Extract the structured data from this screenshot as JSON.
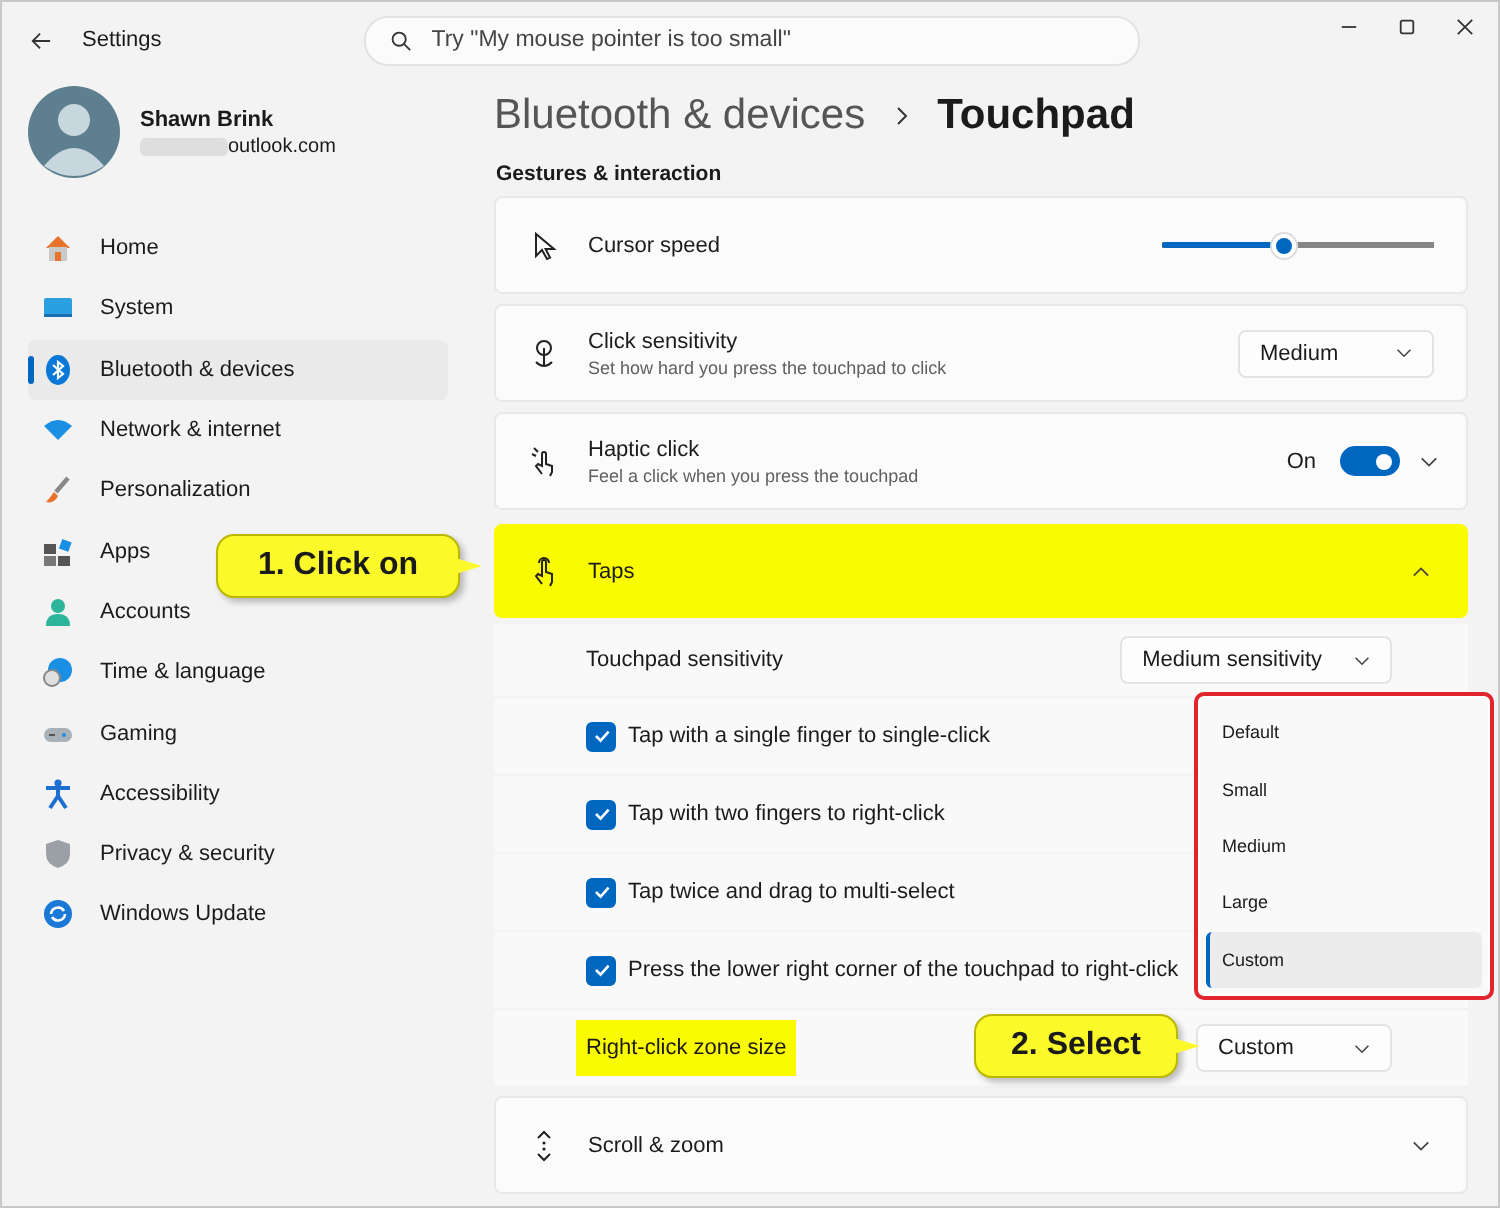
{
  "window": {
    "title": "Settings"
  },
  "search": {
    "placeholder": "Try \"My mouse pointer is too small\""
  },
  "user": {
    "name": "Shawn Brink",
    "email": "outlook.com"
  },
  "sidebar": {
    "items": [
      {
        "label": "Home",
        "selected": false
      },
      {
        "label": "System",
        "selected": false
      },
      {
        "label": "Bluetooth & devices",
        "selected": true
      },
      {
        "label": "Network & internet",
        "selected": false
      },
      {
        "label": "Personalization",
        "selected": false
      },
      {
        "label": "Apps",
        "selected": false
      },
      {
        "label": "Accounts",
        "selected": false
      },
      {
        "label": "Time & language",
        "selected": false
      },
      {
        "label": "Gaming",
        "selected": false
      },
      {
        "label": "Accessibility",
        "selected": false
      },
      {
        "label": "Privacy & security",
        "selected": false
      },
      {
        "label": "Windows Update",
        "selected": false
      }
    ]
  },
  "breadcrumb": {
    "parent": "Bluetooth & devices",
    "current": "Touchpad"
  },
  "section": "Gestures & interaction",
  "settings": [
    {
      "kind": "slider",
      "label": "Cursor speed",
      "level": 0.45
    },
    {
      "kind": "dropdown",
      "label": "Click sensitivity",
      "description": "Set how hard you press the touchpad to click",
      "value": "Medium"
    },
    {
      "kind": "toggle",
      "label": "Haptic click",
      "description": "Feel a click when you press the touchpad",
      "state_text": "On",
      "on": true,
      "expanded": false
    },
    {
      "kind": "expander",
      "label": "Taps",
      "expanded": true,
      "highlighted": true,
      "children": [
        {
          "kind": "dropdown",
          "label": "Touchpad sensitivity",
          "value": "Medium sensitivity",
          "highlighted": false
        },
        {
          "kind": "checkbox",
          "label": "Tap with a single finger to single-click",
          "checked": true
        },
        {
          "kind": "checkbox",
          "label": "Tap with two fingers to right-click",
          "checked": true
        },
        {
          "kind": "checkbox",
          "label": "Tap twice and drag to multi-select",
          "checked": true
        },
        {
          "kind": "checkbox",
          "label": "Press the lower right corner of the touchpad to right-click",
          "checked": true
        },
        {
          "kind": "dropdown",
          "label": "Right-click zone size",
          "value": "Custom",
          "highlighted": true
        }
      ]
    },
    {
      "kind": "expander",
      "label": "Scroll & zoom",
      "expanded": false,
      "highlighted": false
    }
  ],
  "dropdown_menu": {
    "items": [
      {
        "label": "Default",
        "selected": false
      },
      {
        "label": "Small",
        "selected": false
      },
      {
        "label": "Medium",
        "selected": false
      },
      {
        "label": "Large",
        "selected": false
      },
      {
        "label": "Custom",
        "selected": true
      }
    ]
  },
  "callouts": [
    "1. Click on",
    "2. Select"
  ]
}
